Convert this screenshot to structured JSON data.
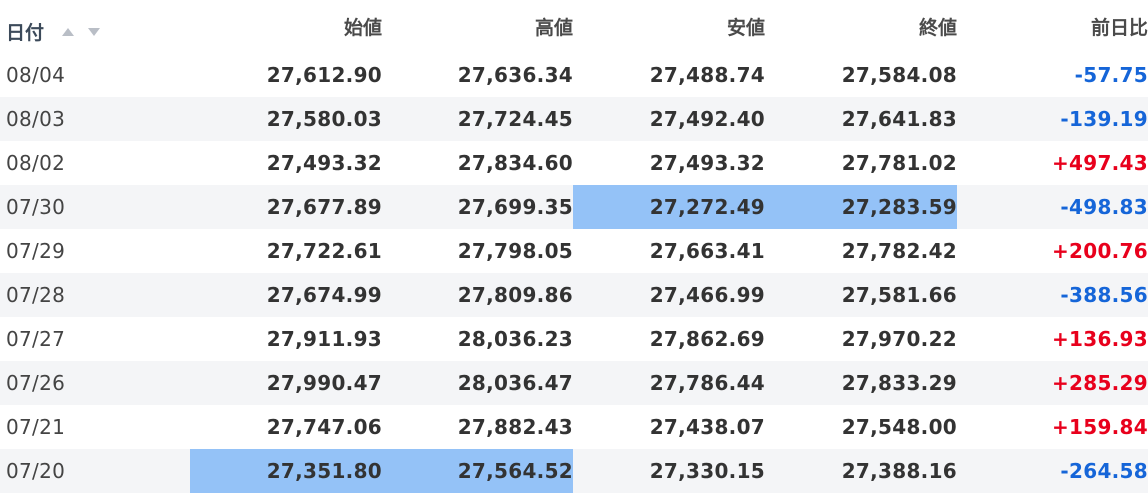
{
  "header": {
    "date": "日付",
    "open": "始値",
    "high": "高値",
    "low": "安値",
    "close": "終値",
    "change": "前日比",
    "sort_icons": [
      "sort-ascending-icon",
      "sort-descending-icon"
    ]
  },
  "colors": {
    "up": "#e8001c",
    "down": "#1565d8",
    "selection": "#94c2f7",
    "stripe": "#f4f5f7"
  },
  "rows": [
    {
      "date": "08/04",
      "open": "27,612.90",
      "high": "27,636.34",
      "low": "27,488.74",
      "close": "27,584.08",
      "change": "-57.75"
    },
    {
      "date": "08/03",
      "open": "27,580.03",
      "high": "27,724.45",
      "low": "27,492.40",
      "close": "27,641.83",
      "change": "-139.19"
    },
    {
      "date": "08/02",
      "open": "27,493.32",
      "high": "27,834.60",
      "low": "27,493.32",
      "close": "27,781.02",
      "change": "+497.43"
    },
    {
      "date": "07/30",
      "open": "27,677.89",
      "high": "27,699.35",
      "low": "27,272.49",
      "close": "27,283.59",
      "change": "-498.83"
    },
    {
      "date": "07/29",
      "open": "27,722.61",
      "high": "27,798.05",
      "low": "27,663.41",
      "close": "27,782.42",
      "change": "+200.76"
    },
    {
      "date": "07/28",
      "open": "27,674.99",
      "high": "27,809.86",
      "low": "27,466.99",
      "close": "27,581.66",
      "change": "-388.56"
    },
    {
      "date": "07/27",
      "open": "27,911.93",
      "high": "28,036.23",
      "low": "27,862.69",
      "close": "27,970.22",
      "change": "+136.93"
    },
    {
      "date": "07/26",
      "open": "27,990.47",
      "high": "28,036.47",
      "low": "27,786.44",
      "close": "27,833.29",
      "change": "+285.29"
    },
    {
      "date": "07/21",
      "open": "27,747.06",
      "high": "27,882.43",
      "low": "27,438.07",
      "close": "27,548.00",
      "change": "+159.84"
    },
    {
      "date": "07/20",
      "open": "27,351.80",
      "high": "27,564.52",
      "low": "27,330.15",
      "close": "27,388.16",
      "change": "-264.58"
    }
  ],
  "highlighted_cells": [
    {
      "row": 3,
      "column": "low"
    },
    {
      "row": 3,
      "column": "close"
    },
    {
      "row": 9,
      "column": "open"
    },
    {
      "row": 9,
      "column": "high"
    }
  ]
}
